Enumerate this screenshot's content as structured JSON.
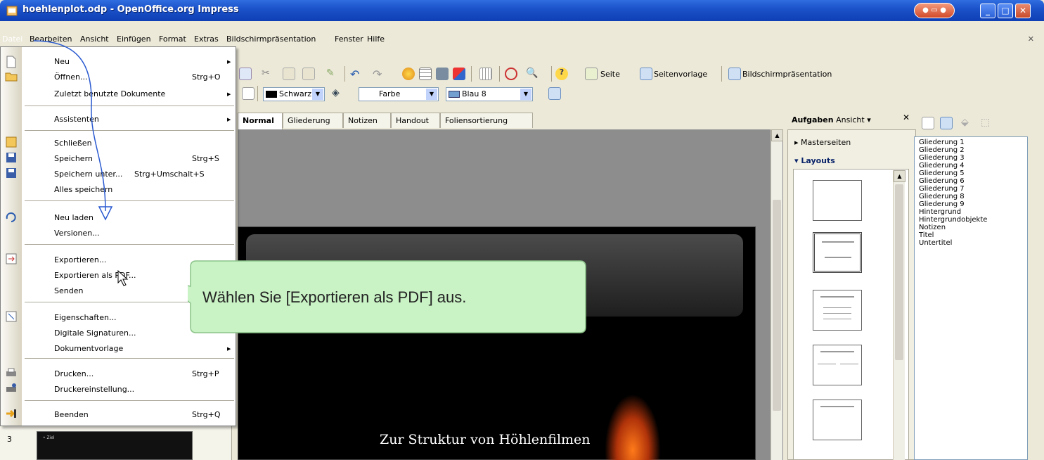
{
  "window": {
    "title": "hoehlenplot.odp - OpenOffice.org Impress"
  },
  "menubar": {
    "items": [
      "Datei",
      "Bearbeiten",
      "Ansicht",
      "Einfügen",
      "Format",
      "Extras",
      "Bildschirmpräsentation",
      "Fenster",
      "Hilfe"
    ]
  },
  "toolbar": {
    "seite": "Seite",
    "seitenvorlage": "Seitenvorlage",
    "bildschirmpraesentation": "Bildschirmpräsentation"
  },
  "formatbar": {
    "linecolor": "Schwarz",
    "fillstyle": "Farbe",
    "fillcolor": "Blau 8"
  },
  "tabs": [
    "Normal",
    "Gliederung",
    "Notizen",
    "Handout",
    "Foliensortierung"
  ],
  "taskpane": {
    "title_bold": "Aufgaben",
    "title_rest": "Ansicht",
    "masterseiten": "Masterseiten",
    "layouts": "Layouts"
  },
  "styles": [
    "Gliederung 1",
    "Gliederung 2",
    "Gliederung 3",
    "Gliederung 4",
    "Gliederung 5",
    "Gliederung 6",
    "Gliederung 7",
    "Gliederung 8",
    "Gliederung 9",
    "Hintergrund",
    "Hintergrundobjekte",
    "Notizen",
    "Titel",
    "Untertitel"
  ],
  "filemenu": {
    "neu": "Neu",
    "oeffnen": "Öffnen...",
    "oeffnen_sc": "Strg+O",
    "zuletzt": "Zuletzt benutzte Dokumente",
    "assistenten": "Assistenten",
    "schliessen": "Schließen",
    "speichern": "Speichern",
    "speichern_sc": "Strg+S",
    "speichern_unter": "Speichern unter...",
    "speichern_unter_sc": "Strg+Umschalt+S",
    "alles": "Alles speichern",
    "neu_laden": "Neu laden",
    "versionen": "Versionen...",
    "exportieren": "Exportieren...",
    "export_pdf": "Exportieren als PDF...",
    "senden": "Senden",
    "eigenschaften": "Eigenschaften...",
    "signaturen": "Digitale Signaturen...",
    "dokumentvorlage": "Dokumentvorlage",
    "drucken": "Drucken...",
    "drucken_sc": "Strg+P",
    "druckereinstellung": "Druckereinstellung...",
    "beenden": "Beenden",
    "beenden_sc": "Strg+Q"
  },
  "callout": {
    "text": "Wählen Sie [Exportieren als PDF] aus."
  },
  "slide": {
    "subtitle": "Zur Struktur von Höhlenfilmen"
  },
  "thumb": {
    "number": "3",
    "label": "• Ziel"
  }
}
